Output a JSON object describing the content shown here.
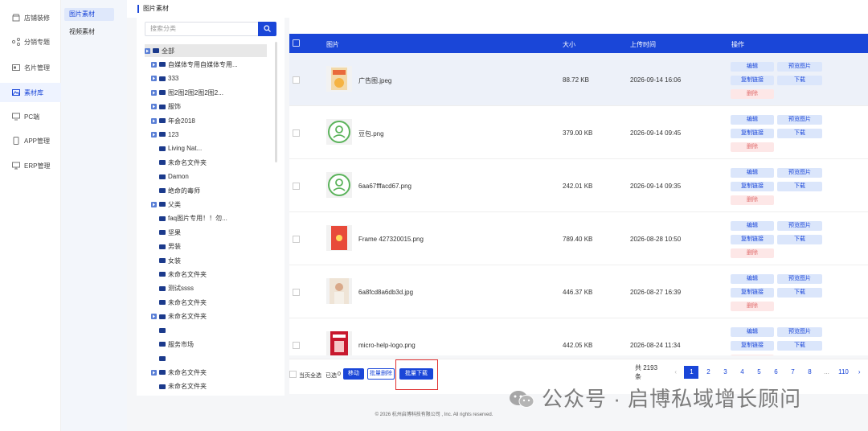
{
  "nav_primary": [
    {
      "label": "店铺装修",
      "icon": "shop-icon"
    },
    {
      "label": "分销专题",
      "icon": "share-icon"
    },
    {
      "label": "名片管理",
      "icon": "card-icon"
    },
    {
      "label": "素材库",
      "icon": "image-icon",
      "active": true
    },
    {
      "label": "PC端",
      "icon": "monitor-icon"
    },
    {
      "label": "APP管理",
      "icon": "phone-icon"
    },
    {
      "label": "ERP管理",
      "icon": "desktop-icon"
    }
  ],
  "nav_secondary": [
    {
      "label": "图片素材",
      "active": true
    },
    {
      "label": "视频素材"
    }
  ],
  "breadcrumb": "图片素材",
  "tree": {
    "search_placeholder": "搜索分类",
    "nodes": [
      {
        "label": "全部",
        "level": 0,
        "expand": true,
        "selected": true
      },
      {
        "label": "自媒体专用自媒体专用...",
        "level": 1,
        "expand": true
      },
      {
        "label": "333",
        "level": 1,
        "expand": true
      },
      {
        "label": "图2图2图2图2图2...",
        "level": 1,
        "expand": true
      },
      {
        "label": "服饰",
        "level": 1,
        "expand": true
      },
      {
        "label": "年会2018",
        "level": 1,
        "expand": true
      },
      {
        "label": "123",
        "level": 1,
        "expand": true
      },
      {
        "label": "Living Nat...",
        "level": 2,
        "expand": false
      },
      {
        "label": "未命名文件夹",
        "level": 2,
        "expand": false
      },
      {
        "label": "Damon",
        "level": 2,
        "expand": false
      },
      {
        "label": "绝命的毒师",
        "level": 2,
        "expand": false
      },
      {
        "label": "父类",
        "level": 1,
        "expand": true
      },
      {
        "label": "faq图片专用！！勿...",
        "level": 2,
        "expand": false
      },
      {
        "label": "坚果",
        "level": 2,
        "expand": false
      },
      {
        "label": "男装",
        "level": 2,
        "expand": false
      },
      {
        "label": "女装",
        "level": 2,
        "expand": false
      },
      {
        "label": "未命名文件夹",
        "level": 2,
        "expand": false
      },
      {
        "label": "测试ssss",
        "level": 2,
        "expand": false
      },
      {
        "label": "未命名文件夹",
        "level": 2,
        "expand": false
      },
      {
        "label": "未命名文件夹",
        "level": 1,
        "expand": true
      },
      {
        "label": "",
        "level": 2,
        "expand": false
      },
      {
        "label": "服务市场",
        "level": 2,
        "expand": false
      },
      {
        "label": "",
        "level": 2,
        "expand": false
      },
      {
        "label": "未命名文件夹",
        "level": 1,
        "expand": true
      },
      {
        "label": "未命名文件夹",
        "level": 2,
        "expand": false
      }
    ]
  },
  "table": {
    "headers": {
      "image": "图片",
      "size": "大小",
      "upload_time": "上传时间",
      "actions": "操作"
    },
    "actions": {
      "edit": "编辑",
      "preview": "预览图片",
      "copy_link": "复制链接",
      "download": "下载",
      "delete": "删除"
    },
    "rows": [
      {
        "name": "广告图.jpeg",
        "size": "88.72 KB",
        "time": "2026-09-14 16:06",
        "thumb": "food"
      },
      {
        "name": "豆包.png",
        "size": "379.00 KB",
        "time": "2026-09-14 09:45",
        "thumb": "logo-green"
      },
      {
        "name": "6aa67fffacd67.png",
        "size": "242.01 KB",
        "time": "2026-09-14 09:35",
        "thumb": "logo-green"
      },
      {
        "name": "Frame 427320015.png",
        "size": "789.40 KB",
        "time": "2026-08-28 10:50",
        "thumb": "red-card"
      },
      {
        "name": "6a8fcd8a6db3d.jpg",
        "size": "446.37 KB",
        "time": "2026-08-27 16:39",
        "thumb": "person"
      },
      {
        "name": "micro-help-logo.png",
        "size": "442.05 KB",
        "time": "2026-08-24 11:34",
        "thumb": "red-poster"
      }
    ]
  },
  "footer": {
    "select_all": "当页全选",
    "selected_label": "已选",
    "selected_count": "0",
    "move": "移动",
    "batch_delete": "批量删除",
    "batch_download": "批量下载",
    "total": "共 2193 条",
    "pages": [
      "1",
      "2",
      "3",
      "4",
      "5",
      "6",
      "7",
      "8",
      "...",
      "110"
    ],
    "current_page": "1"
  },
  "copyright": "© 2026 杭州启博科技有限公司 , Inc. All rights reserved.",
  "watermark": "公众号 · 启博私域增长顾问",
  "colors": {
    "accent": "#1a46d8",
    "danger": "#e03030"
  }
}
